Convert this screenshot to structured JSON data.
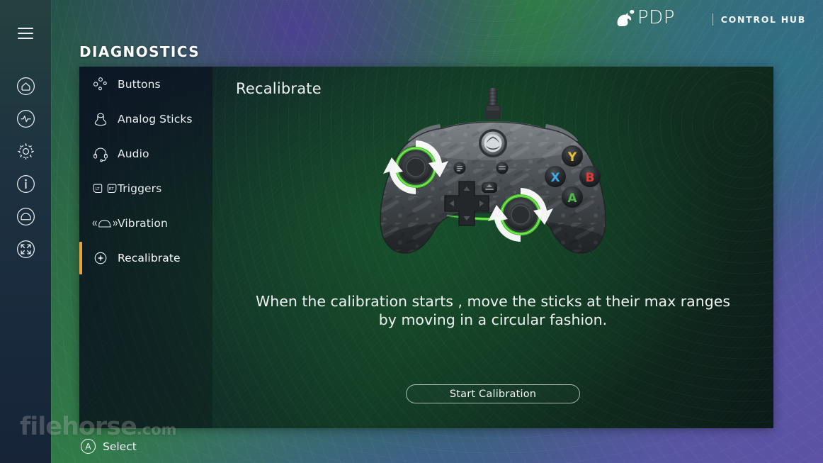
{
  "brand": {
    "logo_text": "PDP",
    "logo_icon": "pdp-dog-mark",
    "separator": "|",
    "sub_text": "CONTROL HUB"
  },
  "page": {
    "title": "DIAGNOSTICS"
  },
  "rail": {
    "menu_icon": "hamburger-menu-icon",
    "items": [
      {
        "icon": "home-icon",
        "name": "home"
      },
      {
        "icon": "activity-icon",
        "name": "activity"
      },
      {
        "icon": "gear-icon",
        "name": "settings"
      },
      {
        "icon": "info-icon",
        "name": "info"
      },
      {
        "icon": "gamepad-icon",
        "name": "devices"
      },
      {
        "icon": "collapse-icon",
        "name": "collapse"
      }
    ]
  },
  "menu": {
    "items": [
      {
        "label": "Buttons",
        "icon": "buttons-icon",
        "active": false
      },
      {
        "label": "Analog Sticks",
        "icon": "stick-icon",
        "active": false
      },
      {
        "label": "Audio",
        "icon": "headset-icon",
        "active": false
      },
      {
        "label": "Triggers",
        "icon": "triggers-icon",
        "active": false
      },
      {
        "label": "Vibration",
        "icon": "vibration-icon",
        "active": false
      },
      {
        "label": "Recalibrate",
        "icon": "recalibrate-icon",
        "active": true
      }
    ]
  },
  "content": {
    "title": "Recalibrate",
    "instruction_line1": "When the calibration starts , move the sticks at their max ranges",
    "instruction_line2": "by moving in a circular fashion.",
    "start_button": "Start Calibration",
    "controller": {
      "name": "xbox-controller",
      "face_buttons": [
        {
          "label": "Y",
          "color": "#e8c132"
        },
        {
          "label": "X",
          "color": "#3fa9e8"
        },
        {
          "label": "B",
          "color": "#e03b36"
        },
        {
          "label": "A",
          "color": "#4fb949"
        }
      ],
      "led_color": "#46c52a",
      "rotation_arrows": "circular-rotation-arrows"
    }
  },
  "footer": {
    "badge": "A",
    "label": "Select"
  },
  "watermark": {
    "name": "filehorse",
    "dotcom": ".com"
  },
  "colors": {
    "accent_orange": "#e8a33d",
    "panel_green": "#17502c",
    "rail_dark": "#1d3140",
    "bg_purple": "#5d52a8",
    "brand_white": "#ffffff"
  }
}
